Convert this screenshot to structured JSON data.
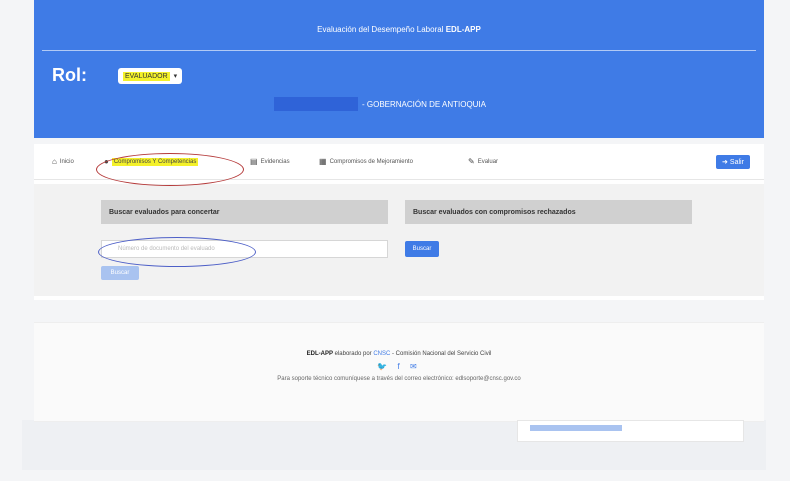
{
  "header": {
    "title_prefix": "Evaluación del Desempeño Laboral",
    "title_app": "EDL-APP",
    "rol_label": "Rol:",
    "role_value": "EVALUADOR",
    "role_caret": "▾",
    "entity": "- GOBERNACIÓN DE ANTIOQUIA"
  },
  "nav": {
    "items": [
      {
        "icon": "⌂",
        "label": "Inicio"
      },
      {
        "icon": "●",
        "label": "Compromisos Y Competencias"
      },
      {
        "icon": "▤",
        "label": "Evidencias"
      },
      {
        "icon": "▦",
        "label": "Compromisos de Mejoramiento"
      },
      {
        "icon": "✎",
        "label": "Evaluar"
      }
    ],
    "logout": "Salir",
    "logout_icon": "➜"
  },
  "search": {
    "left_heading": "Buscar evaluados para concertar",
    "right_heading": "Buscar evaluados con compromisos rechazados",
    "input_placeholder": "Número de documento del evaluado",
    "search_button": "Buscar",
    "secondary_button": "Buscar"
  },
  "footer": {
    "app": "EDL-APP",
    "made_by": "elaborado por",
    "cnsc": "CNSC",
    "commission": "- Comisión Nacional del Servicio Civil",
    "social_icons": "🐦 f ✉",
    "support": "Para soporte técnico comuníquese a través del correo electrónico: edlsoporte@cnsc.gov.co"
  },
  "colors": {
    "primary": "#3f7be6",
    "highlight": "#f4f12a",
    "annotation_red": "#b53a3a",
    "annotation_blue": "#4d5fc7"
  }
}
